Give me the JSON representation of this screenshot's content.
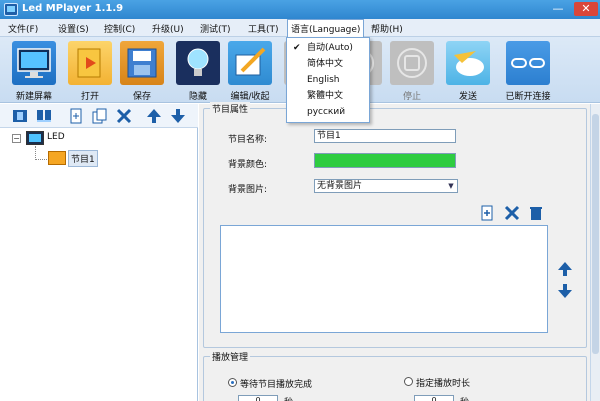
{
  "window": {
    "title": "Led MPlayer 1.1.9",
    "minimize": "—",
    "close": "✕"
  },
  "menu": [
    {
      "label": "文件(F)"
    },
    {
      "label": "设置(S)"
    },
    {
      "label": "控制(C)"
    },
    {
      "label": "升级(U)"
    },
    {
      "label": "测试(T)"
    },
    {
      "label": "工具(T)"
    },
    {
      "label": "语言(Language)"
    },
    {
      "label": "帮助(H)"
    }
  ],
  "toolbar": [
    {
      "label": "新建屏幕",
      "icon": "monitor-icon",
      "color": "#1d6fc2"
    },
    {
      "label": "打开",
      "icon": "folder-open-icon",
      "color": "#f3b233"
    },
    {
      "label": "保存",
      "icon": "save-icon",
      "color": "#4a90d9"
    },
    {
      "label": "隐藏",
      "icon": "lightbulb-icon",
      "color": "#1a2f5e"
    },
    {
      "label": "编辑/收起",
      "icon": "pencil-icon",
      "color": "#2f8bd1"
    },
    {
      "label": "",
      "icon": "play-icon",
      "color": "#bfbfbf"
    },
    {
      "label": "",
      "icon": "pause-icon",
      "color": "#bfbfbf"
    },
    {
      "label": "停止",
      "icon": "stop-icon",
      "color": "#bfbfbf"
    },
    {
      "label": "发送",
      "icon": "send-cloud-icon",
      "color": "#4db3e6"
    },
    {
      "label": "已断开连接",
      "icon": "disconnect-icon",
      "color": "#2c7fd0"
    }
  ],
  "language_menu": {
    "items": [
      {
        "label": "自动(Auto)",
        "checked": true
      },
      {
        "label": "简体中文",
        "checked": false
      },
      {
        "label": "English",
        "checked": false
      },
      {
        "label": "繁體中文",
        "checked": false
      },
      {
        "label": "русский",
        "checked": false
      }
    ],
    "check_mark": "✔"
  },
  "left_toolbar_icons": [
    "film-icon",
    "layout-icon",
    "new-page-icon",
    "copy-icon",
    "delete-icon",
    "move-up-icon",
    "move-down-icon"
  ],
  "tree": {
    "expander": "−",
    "root": "LED",
    "program": "节目1"
  },
  "program_props": {
    "group_title": "节目属性",
    "name_label": "节目名称:",
    "name_value": "节目1",
    "bg_color_label": "背景颜色:",
    "bg_color": "#2ecc40",
    "bg_image_label": "背景图片:",
    "bg_image_value": "无背景图片"
  },
  "playback": {
    "group_title": "播放管理",
    "option_wait": "等待节目播放完成",
    "option_duration": "指定播放时长",
    "wait_value": "0",
    "duration_value": "0",
    "unit": "秒"
  }
}
